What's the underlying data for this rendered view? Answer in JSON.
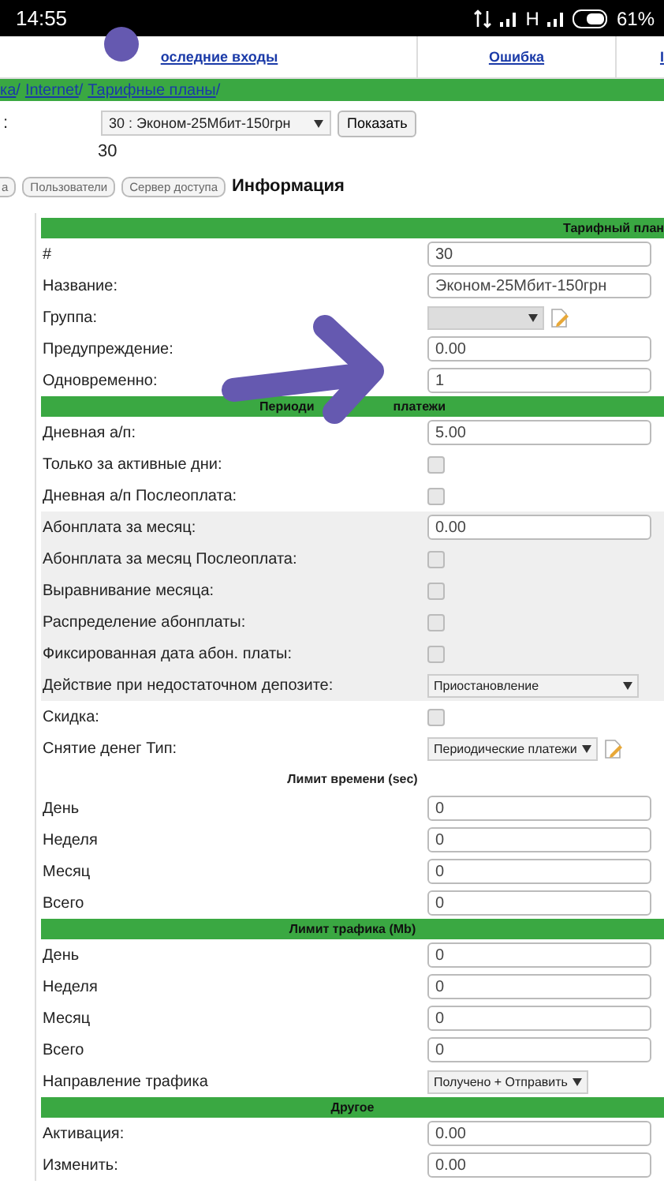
{
  "status_bar": {
    "time": "14:55",
    "network": "H",
    "battery": "61%"
  },
  "nav_links": [
    {
      "label": "оследние входы"
    },
    {
      "label": "Ошибка"
    },
    {
      "label": "I"
    }
  ],
  "breadcrumb": [
    {
      "label": "ка",
      "separator": "/"
    },
    {
      "label": "Internet",
      "separator": "/"
    },
    {
      "label": "Тарифные планы",
      "separator": "/"
    }
  ],
  "plan_picker": {
    "label": ":",
    "value": "30 : Эконом-25Мбит-150грн",
    "button": "Показать",
    "id": "30"
  },
  "tabs": [
    {
      "label": "а",
      "selected": false
    },
    {
      "label": "Пользователи",
      "selected": false
    },
    {
      "label": "Сервер доступа",
      "selected": false
    },
    {
      "label": "Информация",
      "selected": true
    }
  ],
  "form": [
    {
      "kind": "plan_header",
      "parts": [
        "Тарифный план"
      ]
    },
    {
      "kind": "text",
      "label": "#",
      "value": "30"
    },
    {
      "kind": "text",
      "label": "Название:",
      "value": "Эконом-25Мбит-150грн"
    },
    {
      "kind": "select_edit",
      "label": "Группа:"
    },
    {
      "kind": "text",
      "label": "Предупреждение:",
      "value": "0.00"
    },
    {
      "kind": "text",
      "label": "Одновременно:",
      "value": "1"
    },
    {
      "kind": "header",
      "parts": [
        "Периоди",
        "платежи"
      ]
    },
    {
      "kind": "text",
      "label": "Дневная а/п:",
      "value": "5.00"
    },
    {
      "kind": "checkbox",
      "label": "Только за активные дни:",
      "checked": false
    },
    {
      "kind": "checkbox",
      "label": "Дневная а/п Послеоплата:",
      "checked": false
    },
    {
      "kind": "text",
      "label": "Абонплата за месяц:",
      "value": "0.00",
      "shaded": true
    },
    {
      "kind": "checkbox",
      "label": "Абонплата за месяц Послеоплата:",
      "checked": false,
      "shaded": true
    },
    {
      "kind": "checkbox",
      "label": "Выравнивание месяца:",
      "checked": false,
      "shaded": true
    },
    {
      "kind": "checkbox",
      "label": "Распределение абонплаты:",
      "checked": false,
      "shaded": true
    },
    {
      "kind": "checkbox",
      "label": "Фиксированная дата абон. платы:",
      "checked": false,
      "shaded": true
    },
    {
      "kind": "wide_select",
      "label": "Действие при недостаточном депозите:",
      "value": "Приостановление",
      "shaded": true
    },
    {
      "kind": "checkbox",
      "label": "Скидка:",
      "checked": false
    },
    {
      "kind": "select_edit",
      "label": "Снятие денег Тип:",
      "value": "Периодические платежи"
    },
    {
      "kind": "subheader",
      "parts": [
        "Лимит времени (sec)"
      ]
    },
    {
      "kind": "text",
      "label": "День",
      "value": "0"
    },
    {
      "kind": "text",
      "label": "Неделя",
      "value": "0"
    },
    {
      "kind": "text",
      "label": "Месяц",
      "value": "0"
    },
    {
      "kind": "text",
      "label": "Всего",
      "value": "0"
    },
    {
      "kind": "header",
      "parts": [
        "Лимит трафика (Mb)"
      ]
    },
    {
      "kind": "text",
      "label": "День",
      "value": "0"
    },
    {
      "kind": "text",
      "label": "Неделя",
      "value": "0"
    },
    {
      "kind": "text",
      "label": "Месяц",
      "value": "0"
    },
    {
      "kind": "text",
      "label": "Всего",
      "value": "0"
    },
    {
      "kind": "select",
      "label": "Направление трафика",
      "value": "Получено + Отправить"
    },
    {
      "kind": "header",
      "parts": [
        "Другое"
      ]
    },
    {
      "kind": "text",
      "label": "Активация:",
      "value": "0.00"
    },
    {
      "kind": "text",
      "label": "Изменить:",
      "value": "0.00"
    }
  ]
}
